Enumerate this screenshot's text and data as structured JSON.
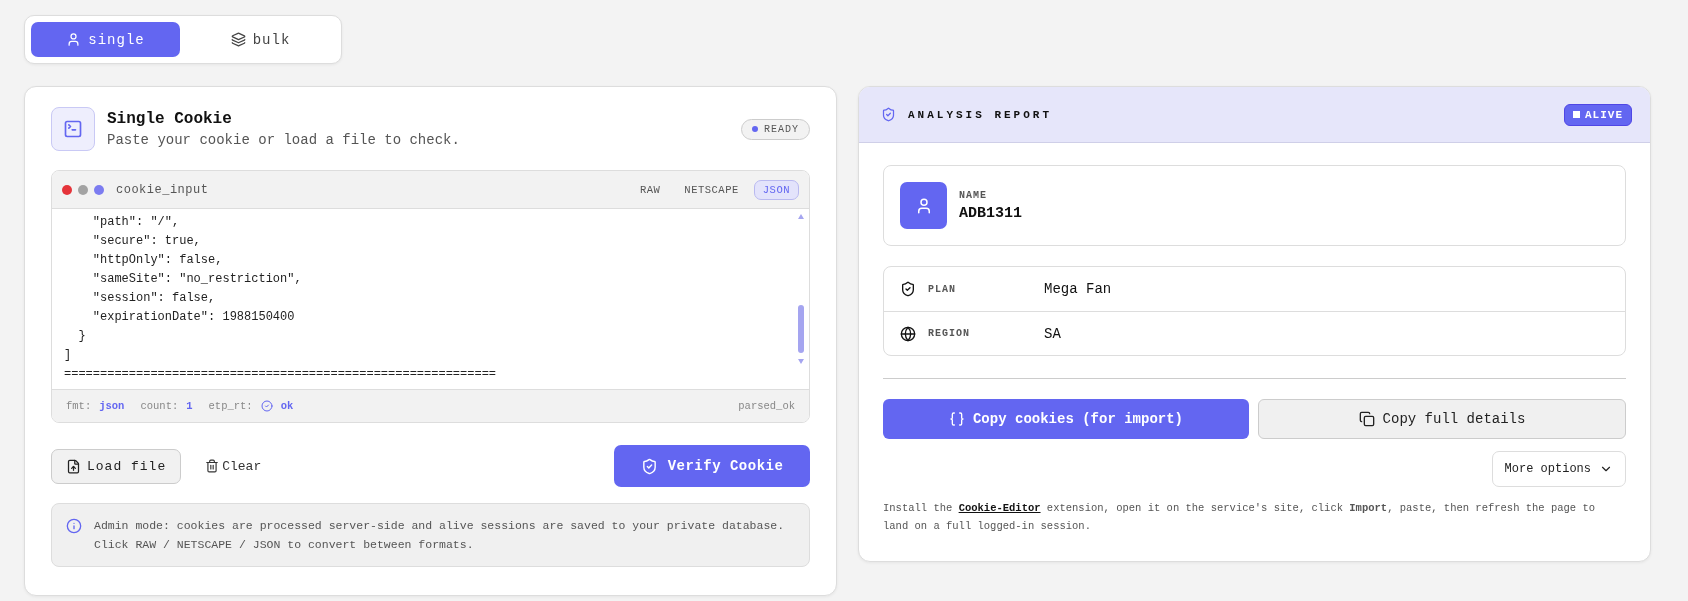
{
  "mode_tabs": [
    {
      "label": "single",
      "kind": "user",
      "selected": true
    },
    {
      "label": "bulk",
      "kind": "layers",
      "selected": false
    }
  ],
  "single_cookie": {
    "title": "Single Cookie",
    "subtitle": "Paste your cookie or load a file to check.",
    "status": "READY",
    "editor": {
      "dots": [
        {
          "color": "#e5343a"
        },
        {
          "color": "#a3a3a3"
        },
        {
          "color": "#7c7cf0"
        }
      ],
      "filename": "cookie_input",
      "formats": [
        {
          "label": "RAW",
          "selected": false
        },
        {
          "label": "NETSCAPE",
          "selected": false
        },
        {
          "label": "JSON",
          "selected": true
        }
      ],
      "code_lines": [
        "    \"path\": \"/\",",
        "    \"secure\": true,",
        "    \"httpOnly\": false,",
        "    \"sameSite\": \"no_restriction\",",
        "    \"session\": false,",
        "    \"expirationDate\": 1988150400",
        "  }",
        "]",
        "============================================================"
      ],
      "footer": {
        "fmt_label": "fmt:",
        "fmt": "json",
        "count_label": "count:",
        "count": "1",
        "etp_label": "etp_rt:",
        "etp": "ok",
        "status": "parsed_ok"
      }
    },
    "load_file": "Load file",
    "clear": "Clear",
    "verify": "Verify Cookie",
    "info": "Admin mode: cookies are processed server-side and alive sessions are saved to your private database. Click RAW / NETSCAPE / JSON to convert between formats."
  },
  "report": {
    "title": "ANALYSIS REPORT",
    "status": "ALIVE",
    "name_label": "NAME",
    "name": "ADB1311",
    "fields": [
      {
        "kind": "plan",
        "label": "PLAN",
        "value": "Mega Fan"
      },
      {
        "kind": "region",
        "label": "REGION",
        "value": "SA"
      }
    ],
    "copy_cookies": "Copy cookies (for import)",
    "copy_details": "Copy full details",
    "more_options": "More options",
    "help": {
      "before": "Install the",
      "link": "Cookie-Editor",
      "after": "extension, open it on the service's site, click **Import**, paste, then refresh the page to land on a full logged-in session."
    }
  }
}
